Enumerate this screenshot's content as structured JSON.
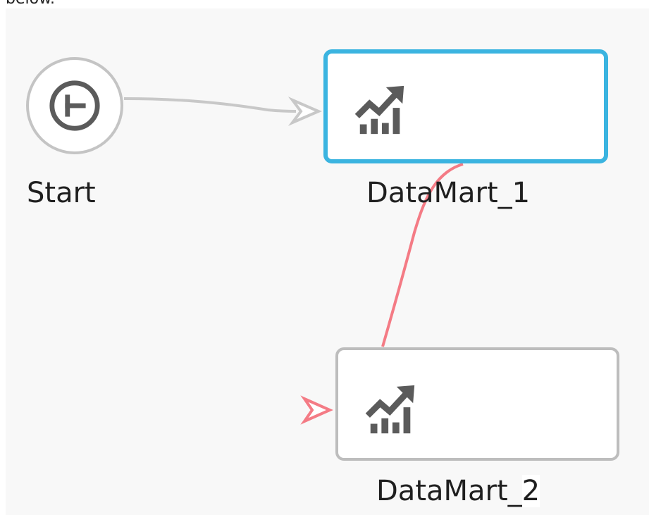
{
  "caption": {
    "text": "below."
  },
  "workflow": {
    "start": {
      "label": "Start",
      "icon": "start-timer-icon"
    },
    "nodes": [
      {
        "label_main": "DataMart_1",
        "label_tail": "",
        "icon": "chart-trend-up-icon",
        "state": "selected"
      },
      {
        "label_main": "DataMart_",
        "label_tail": "2",
        "icon": "chart-trend-up-icon",
        "state": "unselected"
      }
    ],
    "connections": [
      {
        "from": "Start",
        "to": "DataMart_1",
        "color": "#c8c8c8"
      },
      {
        "from": "DataMart_1",
        "to": "DataMart_2",
        "color": "#f47b85"
      }
    ]
  },
  "colors": {
    "canvas_bg": "#f8f8f8",
    "selected_border": "#3bb4e0",
    "node_border": "#bdbdbd",
    "icon": "#5b5b5b",
    "link_default": "#c8c8c8",
    "link_failure": "#f47b85"
  }
}
